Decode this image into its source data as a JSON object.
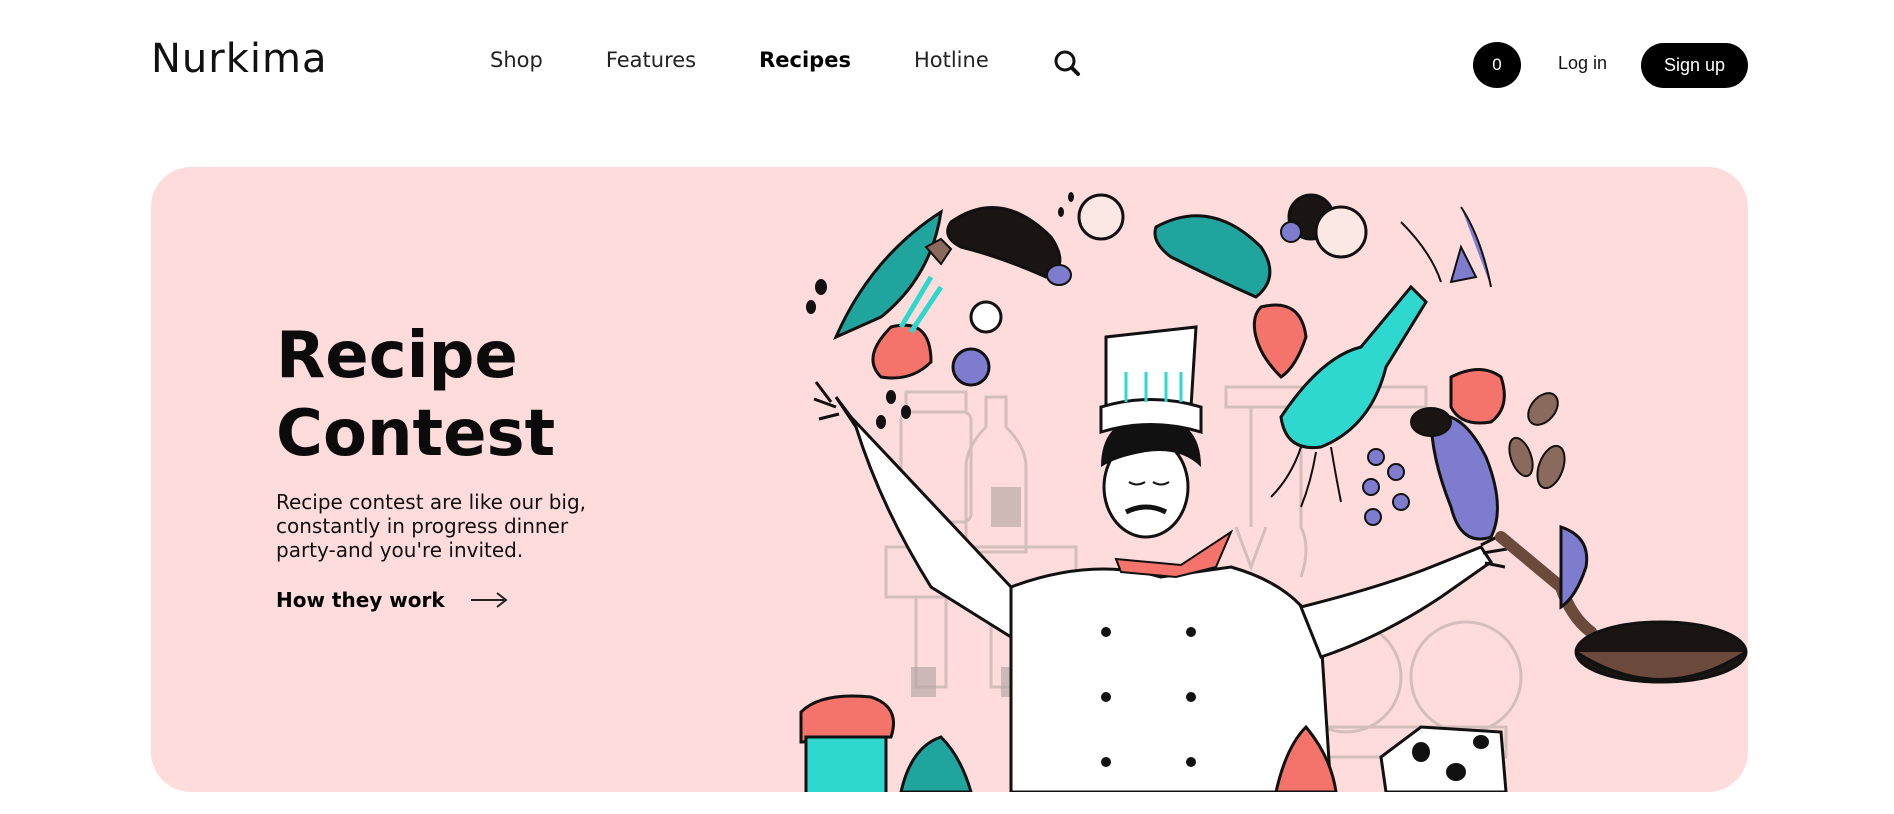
{
  "brand": {
    "logo": "Nurkima"
  },
  "nav": {
    "items": [
      {
        "label": "Shop",
        "active": false
      },
      {
        "label": "Features",
        "active": false
      },
      {
        "label": "Recipes",
        "active": true
      },
      {
        "label": "Hotline",
        "active": false
      }
    ],
    "search_icon": "search-icon"
  },
  "account": {
    "cart_count": "0",
    "login_label": "Log in",
    "signup_label": "Sign up"
  },
  "hero": {
    "title_line1": "Recipe",
    "title_line2": "Contest",
    "description": "Recipe contest are like our big, constantly in progress dinner party-and you're invited.",
    "link_label": "How they work",
    "link_icon": "arrow-right-icon",
    "illustration": "chef-juggling-vegetables-illustration"
  },
  "colors": {
    "hero_background": "#fddcdb",
    "accent_teal": "#2fd8cf",
    "accent_red": "#f4736a",
    "accent_purple": "#7d7ccf",
    "primary_black": "#000000"
  }
}
